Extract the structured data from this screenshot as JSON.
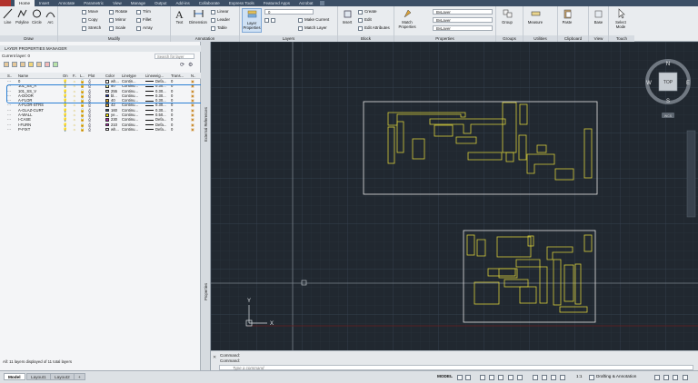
{
  "menubar": {
    "tabs": [
      "Home",
      "Insert",
      "Annotate",
      "Parametric",
      "View",
      "Manage",
      "Output",
      "Add-ins",
      "Collaborate",
      "Express Tools",
      "Featured Apps",
      "Acrobat"
    ],
    "active": "Home"
  },
  "ribbon": {
    "draw": {
      "title": "Draw",
      "tools": [
        "Line",
        "Polyline",
        "Circle",
        "Arc"
      ]
    },
    "modify": {
      "title": "Modify",
      "tools": [
        "Move",
        "Rotate",
        "Trim",
        "Copy",
        "Mirror",
        "Fillet",
        "Stretch",
        "Scale",
        "Array"
      ]
    },
    "annotation": {
      "title": "Annotation",
      "tools": [
        "Text",
        "Dimension",
        "Linear",
        "Leader",
        "Table"
      ]
    },
    "layers": {
      "title": "Layers",
      "big_tool": "Layer Properties",
      "tools": [
        "Make Current",
        "Match Layer"
      ],
      "current_layer": "0"
    },
    "block": {
      "title": "Block",
      "big_tool": "Insert",
      "tools": [
        "Create",
        "Edit",
        "Edit Attributes"
      ]
    },
    "properties": {
      "title": "Properties",
      "big_tool": "Match Properties",
      "dropdowns": [
        "ByLayer",
        "ByLayer",
        "ByLayer"
      ]
    },
    "groups": {
      "title": "Groups",
      "big_tool": "Group"
    },
    "utilities": {
      "title": "Utilities",
      "big_tool": "Measure"
    },
    "clipboard": {
      "title": "Clipboard",
      "big_tool": "Paste"
    },
    "view": {
      "title": "View",
      "big_tool": "Base"
    },
    "touch": {
      "title": "Touch",
      "big_tool": "Select Mode"
    }
  },
  "palette": {
    "title": "LAYER PROPERTIES MANAGER",
    "current_layer_label": "Current layer: 0",
    "search_placeholder": "Search for layer",
    "columns": [
      "S..",
      "Name",
      "On",
      "F..",
      "L..",
      "Plot",
      "Color",
      "Linetype",
      "Lineweig...",
      "Trans...",
      "N.."
    ],
    "layers": [
      {
        "name": "0",
        "color_label": "wh...",
        "color": "#ffffff",
        "linetype": "Contin...",
        "lineweight": "Defa...",
        "trans": "0"
      },
      {
        "name": "101_SS_A",
        "color_label": "50",
        "color": "#e8e08a",
        "linetype": "Continu...",
        "lineweight": "0.30...",
        "trans": "0"
      },
      {
        "name": "101_SS_V",
        "color_label": "255",
        "color": "#f6f6f6",
        "linetype": "Continu...",
        "lineweight": "0.30...",
        "trans": "0"
      },
      {
        "name": "A-DOOR",
        "color_label": "bl...",
        "color": "#1d3bd6",
        "linetype": "Continu...",
        "lineweight": "0.30...",
        "trans": "0"
      },
      {
        "name": "A-FLOR",
        "color_label": "40",
        "color": "#d9a21a",
        "linetype": "Continu...",
        "lineweight": "0.30...",
        "trans": "0"
      },
      {
        "name": "A-FLOR-STRS",
        "color_label": "42",
        "color": "#d7a640",
        "linetype": "Continu...",
        "lineweight": "0.30...",
        "trans": "0"
      },
      {
        "name": "A-GLAZ-CURT",
        "color_label": "160",
        "color": "#27528f",
        "linetype": "Continu...",
        "lineweight": "0.30...",
        "trans": "0"
      },
      {
        "name": "A-WALL",
        "color_label": "ye...",
        "color": "#f2e200",
        "linetype": "Continu...",
        "lineweight": "0.50...",
        "trans": "0"
      },
      {
        "name": "I-CASE",
        "color_label": "230",
        "color": "#b01fb0",
        "linetype": "Continu...",
        "lineweight": "Defa...",
        "trans": "0"
      },
      {
        "name": "I-FURN",
        "color_label": "210",
        "color": "#c21ec2",
        "linetype": "Continu...",
        "lineweight": "Defa...",
        "trans": "0"
      },
      {
        "name": "P-FIXT",
        "color_label": "wh...",
        "color": "#ffffff",
        "linetype": "Continu...",
        "lineweight": "Defa...",
        "trans": "0"
      }
    ],
    "status": "All: 11 layers displayed of 11 total layers",
    "side_labels": [
      "External References",
      "Properties"
    ]
  },
  "viewcube": {
    "top": "TOP",
    "n": "N",
    "s": "S",
    "e": "E",
    "w": "W",
    "wcs": "WCS"
  },
  "ucs": {
    "x": "X",
    "y": "Y"
  },
  "command": {
    "line1": "Command:",
    "line2": "Command:",
    "placeholder": "Type a command"
  },
  "statusbar": {
    "tabs": [
      "Model",
      "Layout1",
      "Layout2"
    ],
    "model_label": "MODEL",
    "scale": "1:1",
    "workspace": "Drafting & Annotation"
  }
}
